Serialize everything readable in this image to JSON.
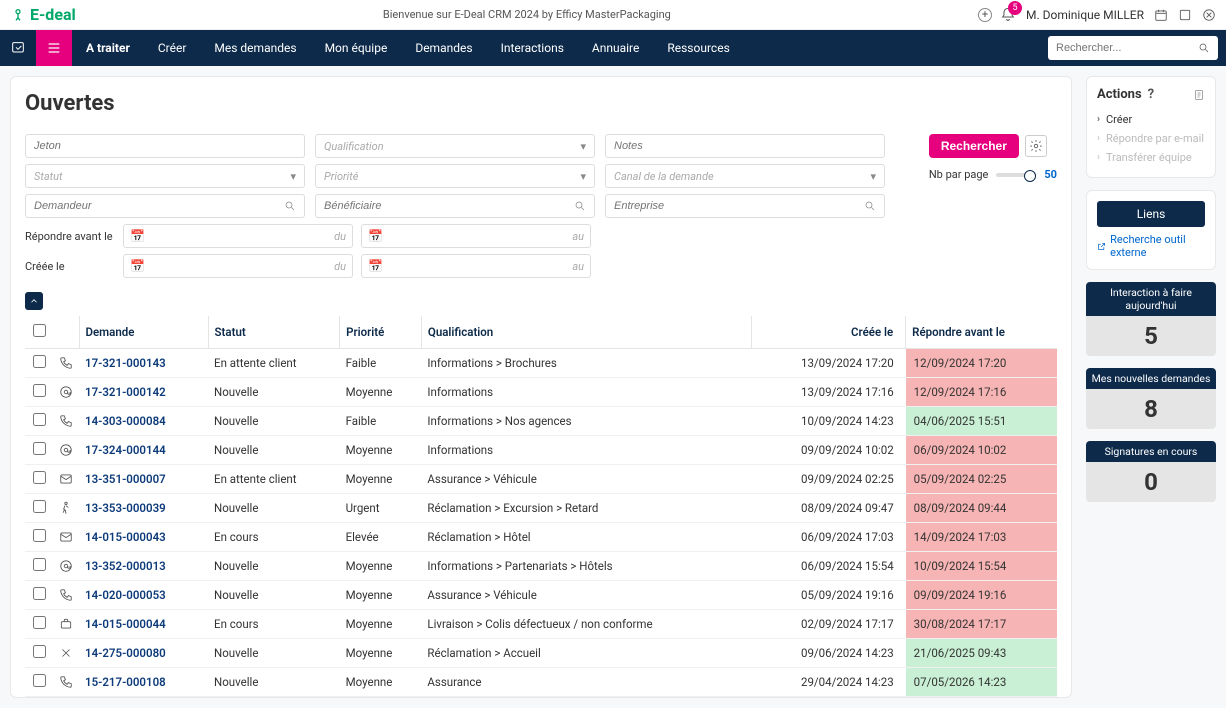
{
  "header": {
    "brand": "E-deal",
    "welcome": "Bienvenue sur E-Deal CRM 2024 by Efficy MasterPackaging",
    "username": "M. Dominique MILLER",
    "notification_count": "5"
  },
  "nav": {
    "items": [
      "A traiter",
      "Créer",
      "Mes demandes",
      "Mon équipe",
      "Demandes",
      "Interactions",
      "Annuaire",
      "Ressources"
    ],
    "search_placeholder": "Rechercher..."
  },
  "page": {
    "title": "Ouvertes"
  },
  "filters": {
    "jeton": "Jeton",
    "qualification": "Qualification",
    "notes": "Notes",
    "statut": "Statut",
    "priorite": "Priorité",
    "canal": "Canal de la demande",
    "demandeur": "Demandeur",
    "beneficiaire": "Bénéficiaire",
    "entreprise": "Entreprise",
    "repondre_avant": "Répondre avant le",
    "creee_le": "Créée le",
    "du": "du",
    "au": "au",
    "search_btn": "Rechercher",
    "perpage_label": "Nb par page",
    "perpage_value": "50"
  },
  "table": {
    "headers": {
      "demande": "Demande",
      "statut": "Statut",
      "priorite": "Priorité",
      "qualification": "Qualification",
      "creee_le": "Créée le",
      "repondre_avant": "Répondre avant le"
    },
    "rows": [
      {
        "icon": "phone",
        "demande": "17-321-000143",
        "statut": "En attente client",
        "priorite": "Faible",
        "qual": "Informations > Brochures",
        "creee": "13/09/2024 17:20",
        "resp": "12/09/2024 17:20",
        "cls": "red"
      },
      {
        "icon": "at",
        "demande": "17-321-000142",
        "statut": "Nouvelle",
        "priorite": "Moyenne",
        "qual": "Informations",
        "creee": "13/09/2024 17:16",
        "resp": "12/09/2024 17:16",
        "cls": "red"
      },
      {
        "icon": "phone",
        "demande": "14-303-000084",
        "statut": "Nouvelle",
        "priorite": "Faible",
        "qual": "Informations > Nos agences",
        "creee": "10/09/2024 14:23",
        "resp": "04/06/2025 15:51",
        "cls": "green"
      },
      {
        "icon": "at",
        "demande": "17-324-000144",
        "statut": "Nouvelle",
        "priorite": "Moyenne",
        "qual": "Informations",
        "creee": "09/09/2024 10:02",
        "resp": "06/09/2024 10:02",
        "cls": "red"
      },
      {
        "icon": "mail",
        "demande": "13-351-000007",
        "statut": "En attente client",
        "priorite": "Moyenne",
        "qual": "Assurance > Véhicule",
        "creee": "09/09/2024 02:25",
        "resp": "05/09/2024 02:25",
        "cls": "red"
      },
      {
        "icon": "walk",
        "demande": "13-353-000039",
        "statut": "Nouvelle",
        "priorite": "Urgent",
        "qual": "Réclamation > Excursion > Retard",
        "creee": "08/09/2024 09:47",
        "resp": "08/09/2024 09:44",
        "cls": "red"
      },
      {
        "icon": "mail",
        "demande": "14-015-000043",
        "statut": "En cours",
        "priorite": "Elevée",
        "qual": "Réclamation > Hôtel",
        "creee": "06/09/2024 17:03",
        "resp": "14/09/2024 17:03",
        "cls": "red"
      },
      {
        "icon": "at",
        "demande": "13-352-000013",
        "statut": "Nouvelle",
        "priorite": "Moyenne",
        "qual": "Informations > Partenariats > Hôtels",
        "creee": "06/09/2024 15:54",
        "resp": "10/09/2024 15:54",
        "cls": "red"
      },
      {
        "icon": "phone",
        "demande": "14-020-000053",
        "statut": "Nouvelle",
        "priorite": "Moyenne",
        "qual": "Assurance > Véhicule",
        "creee": "05/09/2024 19:16",
        "resp": "09/09/2024 19:16",
        "cls": "red"
      },
      {
        "icon": "brief",
        "demande": "14-015-000044",
        "statut": "En cours",
        "priorite": "Moyenne",
        "qual": "Livraison > Colis défectueux / non conforme",
        "creee": "02/09/2024 17:17",
        "resp": "30/08/2024 17:17",
        "cls": "red"
      },
      {
        "icon": "x",
        "demande": "14-275-000080",
        "statut": "Nouvelle",
        "priorite": "Moyenne",
        "qual": "Réclamation > Accueil",
        "creee": "09/06/2024 14:23",
        "resp": "21/06/2025 09:43",
        "cls": "green"
      },
      {
        "icon": "phone",
        "demande": "15-217-000108",
        "statut": "Nouvelle",
        "priorite": "Moyenne",
        "qual": "Assurance",
        "creee": "29/04/2024 14:23",
        "resp": "07/05/2026 14:23",
        "cls": "green"
      }
    ]
  },
  "actions": {
    "title": "Actions",
    "items": [
      {
        "label": "Créer",
        "enabled": true
      },
      {
        "label": "Répondre par e-mail",
        "enabled": false
      },
      {
        "label": "Transférer équipe",
        "enabled": false
      }
    ]
  },
  "liens": {
    "title": "Liens",
    "ext": "Recherche outil externe"
  },
  "stats": [
    {
      "title": "Interaction à faire aujourd'hui",
      "value": "5"
    },
    {
      "title": "Mes nouvelles demandes",
      "value": "8"
    },
    {
      "title": "Signatures en cours",
      "value": "0"
    }
  ]
}
